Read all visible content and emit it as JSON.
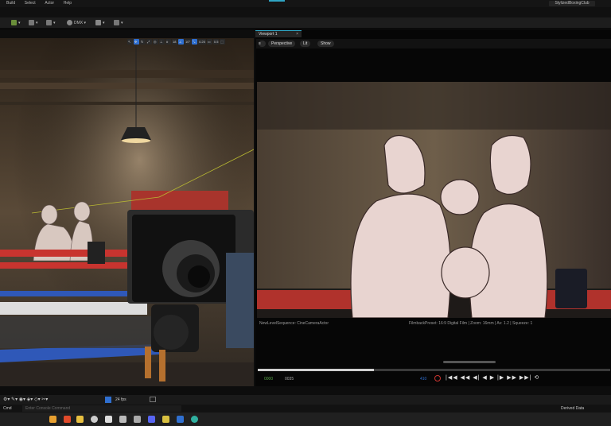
{
  "menu": {
    "items": [
      "Build",
      "Select",
      "Actor",
      "Help"
    ],
    "project": "StylizedBoxingClub"
  },
  "toolbar": {
    "platform": "DMX"
  },
  "left_viewport": {
    "toolbar_items": [
      "18",
      "10°",
      "0.25",
      "0.5"
    ]
  },
  "viewport_tab": {
    "label": "Viewport 1",
    "close": "×"
  },
  "viewport_header": {
    "perspective": "Perspective",
    "lit": "Lit",
    "show": "Show"
  },
  "status": {
    "left": "NewLevelSequence: CineCameraActor",
    "right": "FilmbackPreset: 16:9 Digital Film | Zoom: 16mm | Av: 1.2 | Squeeze: 1"
  },
  "transport": {
    "start_frame": "0000",
    "current": "410",
    "end_frame": "0035",
    "progress": 0.33
  },
  "bottom_toolbar": {
    "fps": "24 fps"
  },
  "cmd": {
    "label": "Cmd",
    "placeholder": "Enter Console Command",
    "right": "Derived Data"
  },
  "colors": {
    "accent": "#2fa5c4",
    "green": "#5aa84a",
    "rope_red": "#c8342f",
    "rope_blue": "#2f58b8"
  }
}
